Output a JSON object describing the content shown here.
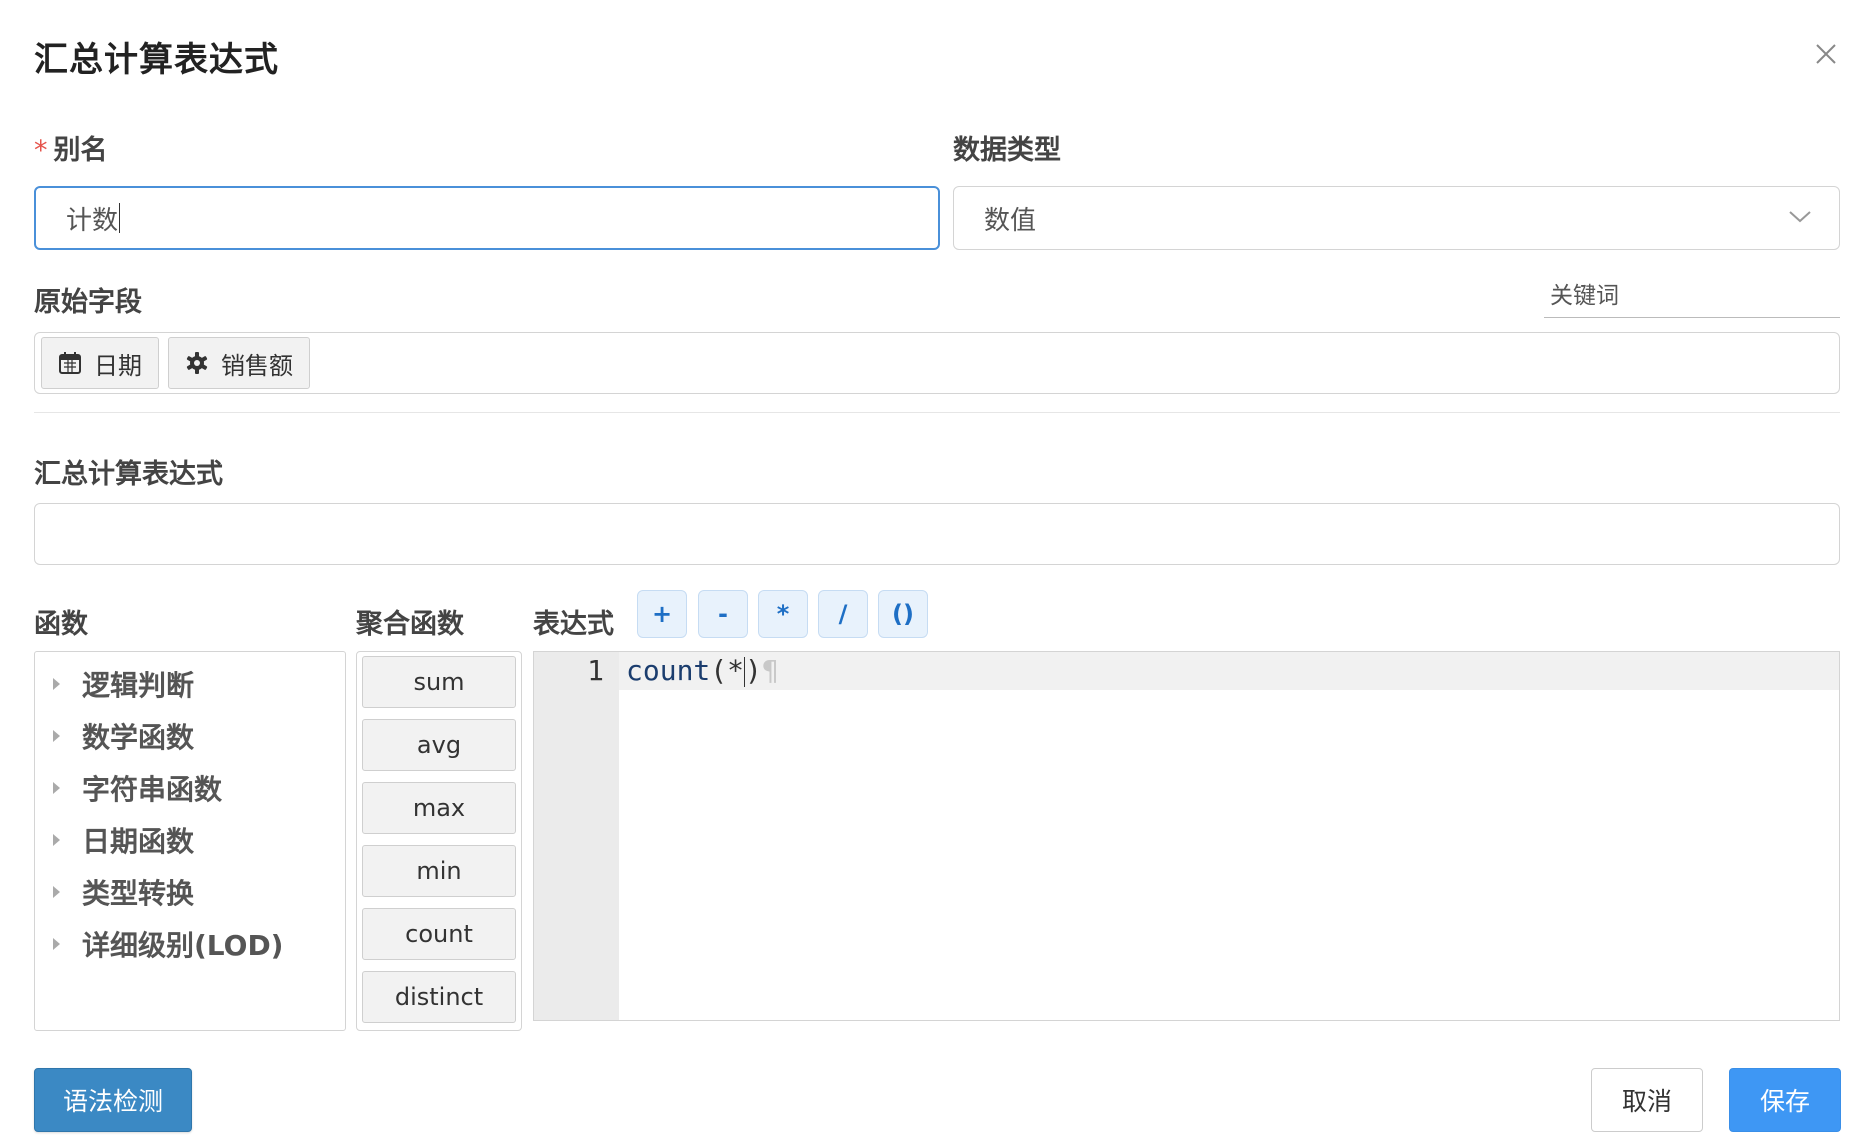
{
  "dialog": {
    "title": "汇总计算表达式"
  },
  "alias": {
    "required_mark": "*",
    "label": "别名",
    "value": "计数"
  },
  "data_type": {
    "label": "数据类型",
    "selected": "数值"
  },
  "source_fields": {
    "label": "原始字段",
    "keyword_placeholder": "关键词",
    "items": [
      {
        "icon": "calendar-icon",
        "label": "日期"
      },
      {
        "icon": "gear-icon",
        "label": "销售额"
      }
    ]
  },
  "expression": {
    "label": "汇总计算表达式",
    "value": ""
  },
  "functions": {
    "label": "函数",
    "categories": [
      "逻辑判断",
      "数学函数",
      "字符串函数",
      "日期函数",
      "类型转换",
      "详细级别(LOD)"
    ]
  },
  "aggregates": {
    "label": "聚合函数",
    "items": [
      "sum",
      "avg",
      "max",
      "min",
      "count",
      "distinct"
    ]
  },
  "editor": {
    "label": "表达式",
    "operators": [
      "+",
      "-",
      "*",
      "/",
      "()"
    ],
    "line_number": "1",
    "code_fn": "count",
    "code_before_cursor": "(*",
    "code_after_cursor": ")",
    "eol_mark": "¶"
  },
  "footer": {
    "check_label": "语法检测",
    "cancel_label": "取消",
    "save_label": "保存"
  }
}
